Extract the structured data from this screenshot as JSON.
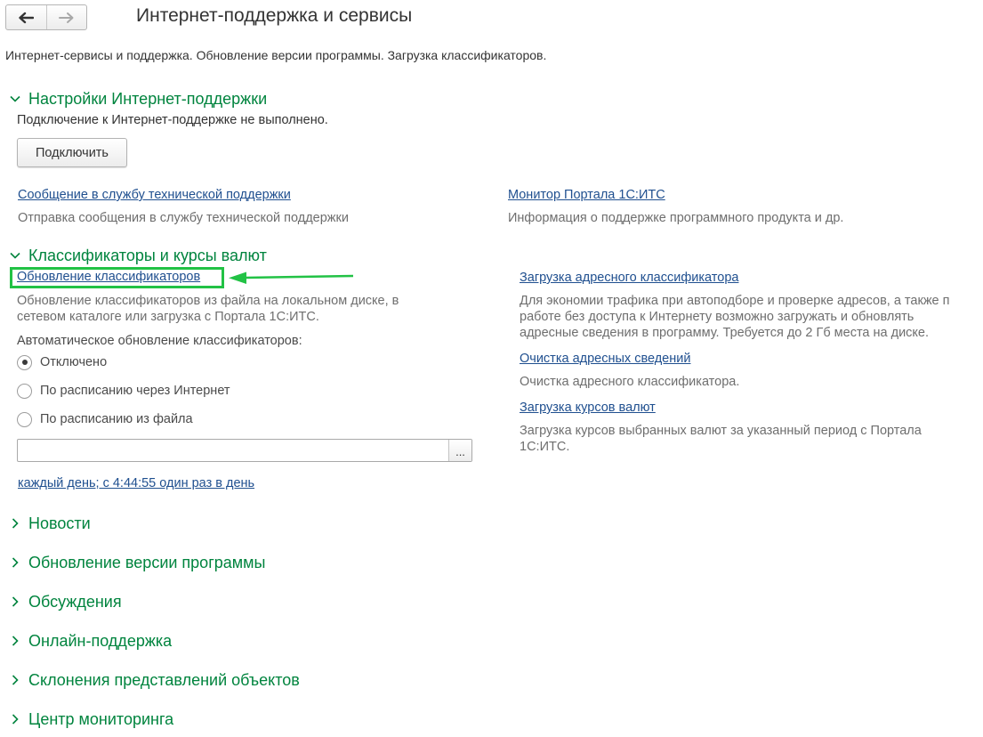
{
  "window": {
    "title": "Интернет-поддержка и сервисы"
  },
  "nav": {
    "back_icon": "arrow-left-icon",
    "forward_icon": "arrow-right-icon"
  },
  "page": {
    "description": "Интернет-сервисы и поддержка. Обновление версии программы. Загрузка классификаторов."
  },
  "support_settings": {
    "title": "Настройки Интернет-поддержки",
    "status": "Подключение к Интернет-поддержке не выполнено.",
    "connect_label": "Подключить",
    "message_link": "Сообщение в службу технической поддержки",
    "message_hint": "Отправка сообщения в службу технической поддержки",
    "monitor_link": "Монитор Портала 1С:ИТС",
    "monitor_hint": "Информация о поддержке программного продукта и др."
  },
  "classifiers": {
    "title": "Классификаторы и курсы валют",
    "update_link": "Обновление классификаторов",
    "update_hint_1": "Обновление классификаторов из файла на локальном диске, в",
    "update_hint_2": "сетевом каталоге или загрузка с Портала 1С:ИТС.",
    "auto_label": "Автоматическое обновление классификаторов:",
    "options": [
      "Отключено",
      "По расписанию через Интернет",
      "По расписанию из файла"
    ],
    "selected_option": 0,
    "file_value": "",
    "browse_label": "...",
    "schedule_link": "каждый день; с 4:44:55 один раз в день",
    "address_link": "Загрузка адресного классификатора",
    "address_hint_1": "Для экономии трафика при автоподборе и проверке адресов, а также п",
    "address_hint_2": "работе без доступа к Интернету возможно загружать и обновлять",
    "address_hint_3": "адресные сведения в программу. Требуется до 2 Гб места на диске.",
    "clear_link": "Очистка адресных сведений",
    "clear_hint": "Очистка адресного классификатора.",
    "rates_link": "Загрузка курсов валют",
    "rates_hint_1": "Загрузка курсов выбранных валют за указанный период с Портала",
    "rates_hint_2": "1С:ИТС."
  },
  "collapsed_sections": [
    "Новости",
    "Обновление версии программы",
    "Обсуждения",
    "Онлайн-поддержка",
    "Склонения представлений объектов",
    "Центр мониторинга"
  ],
  "colors": {
    "section": "#00843e",
    "link": "#1f4f8f",
    "highlight": "#22c245"
  }
}
